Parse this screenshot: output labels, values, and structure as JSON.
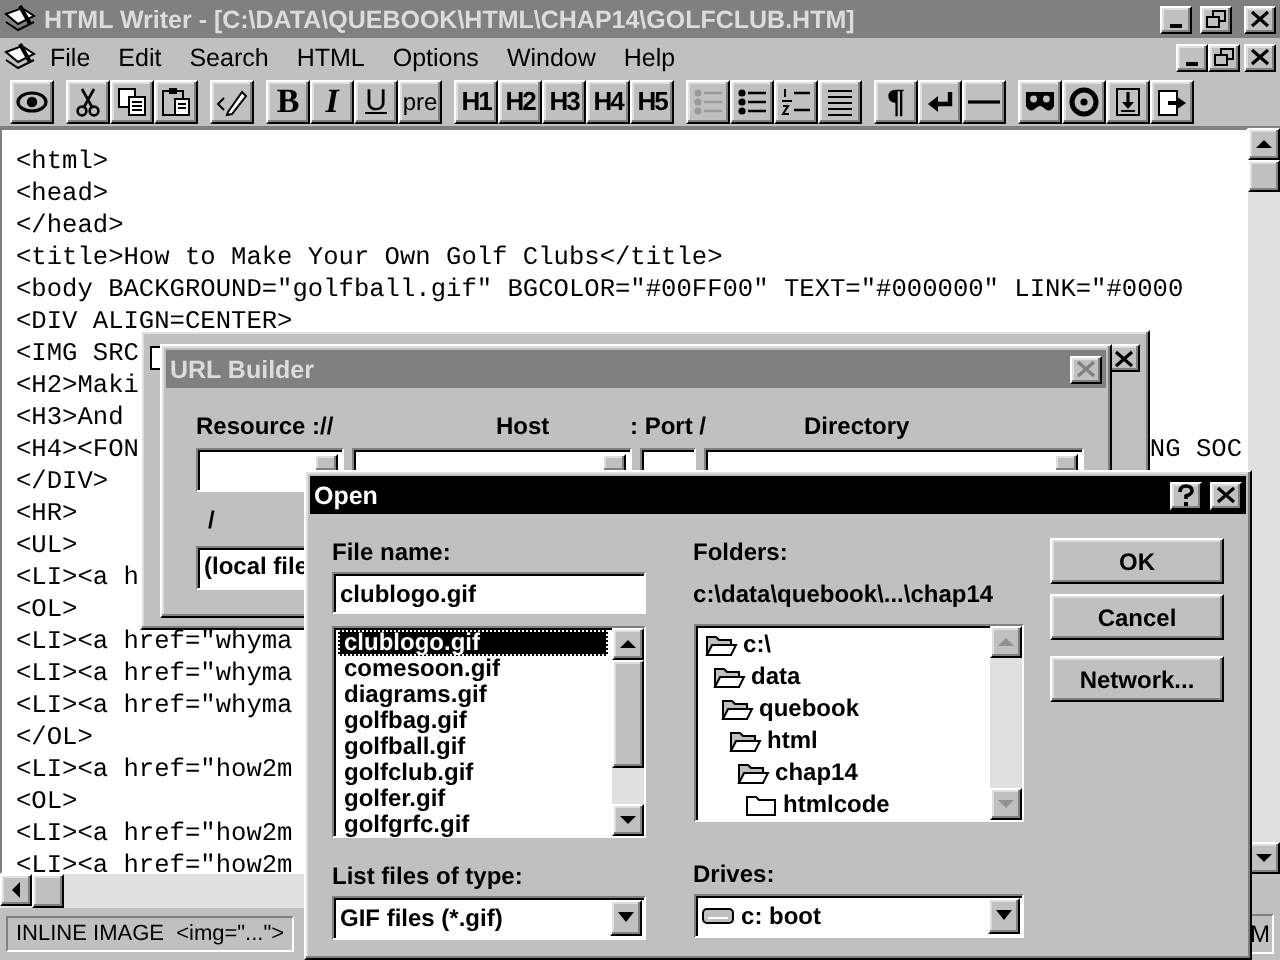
{
  "window": {
    "title": "HTML Writer - [C:\\DATA\\QUEBOOK\\HTML\\CHAP14\\GOLFCLUB.HTM]",
    "active": false
  },
  "menu": [
    "File",
    "Edit",
    "Search",
    "HTML",
    "Options",
    "Window",
    "Help"
  ],
  "toolbar": [
    [
      {
        "kind": "eye",
        "disabled": false
      }
    ],
    [
      {
        "kind": "scissors",
        "disabled": false
      },
      {
        "kind": "copy",
        "disabled": false
      },
      {
        "kind": "paste",
        "disabled": false
      }
    ],
    [
      {
        "kind": "pencil",
        "disabled": false
      }
    ],
    [
      {
        "kind": "bold",
        "label": "B",
        "disabled": false
      },
      {
        "kind": "italic",
        "label": "I",
        "disabled": false
      },
      {
        "kind": "underline",
        "label": "U",
        "disabled": false
      },
      {
        "kind": "plain",
        "label": "pre",
        "disabled": false
      }
    ],
    [
      {
        "kind": "heading",
        "label": "H1",
        "disabled": false
      },
      {
        "kind": "heading",
        "label": "H2",
        "disabled": false
      },
      {
        "kind": "heading",
        "label": "H3",
        "disabled": false
      },
      {
        "kind": "heading",
        "label": "H4",
        "disabled": false
      },
      {
        "kind": "heading",
        "label": "H5",
        "disabled": false
      }
    ],
    [
      {
        "kind": "bullets",
        "disabled": true
      },
      {
        "kind": "bullets",
        "disabled": false
      },
      {
        "kind": "numbers",
        "disabled": false
      },
      {
        "kind": "lines",
        "disabled": false
      }
    ],
    [
      {
        "kind": "bold",
        "label": "¶",
        "disabled": false
      },
      {
        "kind": "enter",
        "disabled": false
      },
      {
        "kind": "rule",
        "disabled": false
      }
    ],
    [
      {
        "kind": "mask",
        "disabled": false
      },
      {
        "kind": "target",
        "disabled": false
      },
      {
        "kind": "download",
        "disabled": false
      },
      {
        "kind": "export",
        "disabled": false
      }
    ]
  ],
  "editor": {
    "lines": [
      {
        "text": "<html>"
      },
      {
        "text": "<head>"
      },
      {
        "text": "</head>"
      },
      {
        "text": "<title>How to Make Your Own Golf Clubs</title>"
      },
      {
        "text": "<body BACKGROUND=\"golfball.gif\" BGCOLOR=\"#00FF00\" TEXT=\"#000000\" LINK=\"#0000"
      },
      {
        "text": "<DIV ALIGN=CENTER>"
      },
      {
        "text": "<IMG SRC"
      },
      {
        "text": "<H2>Maki"
      },
      {
        "text": "<H3>And"
      },
      {
        "text": "<H4><FON",
        "tail": "NG SOC"
      },
      {
        "text": "</DIV>"
      },
      {
        "text": "<HR>"
      },
      {
        "text": "<UL>"
      },
      {
        "text": "<LI><a h"
      },
      {
        "text": "<OL>"
      },
      {
        "text": "<LI><a href=\"whyma"
      },
      {
        "text": "<LI><a href=\"whyma"
      },
      {
        "text": "<LI><a href=\"whyma"
      },
      {
        "text": "</OL>"
      },
      {
        "text": "<LI><a href=\"how2m"
      },
      {
        "text": "<OL>"
      },
      {
        "text": "<LI><a href=\"how2m"
      },
      {
        "text": "<LI><a href=\"how2m"
      }
    ]
  },
  "status_bar": {
    "text": "INLINE IMAGE  <img=\"...\">",
    "tail": "M"
  },
  "url_builder": {
    "title": "URL Builder",
    "active": false,
    "labels": [
      "Resource ://",
      "Host",
      ": Port /",
      "Directory"
    ],
    "separator": "/",
    "local_field": "(local file"
  },
  "open_dialog": {
    "title": "Open",
    "active": true,
    "file_name_label": "File name:",
    "file_name": "clublogo.gif",
    "files": [
      {
        "name": "clublogo.gif",
        "selected": true
      },
      {
        "name": "comesoon.gif",
        "selected": false
      },
      {
        "name": "diagrams.gif",
        "selected": false
      },
      {
        "name": "golfbag.gif",
        "selected": false
      },
      {
        "name": "golfball.gif",
        "selected": false
      },
      {
        "name": "golfclub.gif",
        "selected": false
      },
      {
        "name": "golfer.gif",
        "selected": false
      },
      {
        "name": "golfgrfc.gif",
        "selected": false
      }
    ],
    "folders_label": "Folders:",
    "folder_path": "c:\\data\\quebook\\...\\chap14",
    "folders": [
      {
        "name": "c:\\",
        "open": true,
        "children": [
          {
            "name": "data",
            "open": true,
            "children": [
              {
                "name": "quebook",
                "open": true,
                "children": [
                  {
                    "name": "html",
                    "open": true,
                    "children": [
                      {
                        "name": "chap14",
                        "open": true,
                        "children": [
                          {
                            "name": "htmlcode",
                            "open": false
                          }
                        ]
                      }
                    ]
                  }
                ]
              }
            ]
          }
        ]
      }
    ],
    "type_label": "List files of type:",
    "file_type": "GIF files (*.gif)",
    "drives_label": "Drives:",
    "drive": "c: boot",
    "buttons": [
      "OK",
      "Cancel",
      "Network..."
    ]
  }
}
